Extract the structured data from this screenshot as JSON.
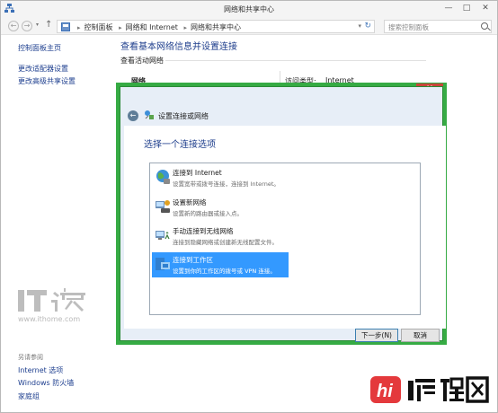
{
  "window": {
    "title": "网络和共享中心",
    "controls": {
      "minimize": "—",
      "maximize": "□",
      "close": "✕"
    }
  },
  "addressbar": {
    "back": "←",
    "forward": "→",
    "up": "↑",
    "crumbs": [
      "控制面板",
      "网络和 Internet",
      "网络和共享中心"
    ],
    "search_placeholder": "搜索控制面板"
  },
  "leftpane": {
    "home": "控制面板主页",
    "links": [
      "更改适配器设置",
      "更改高级共享设置"
    ],
    "see_also_heading": "另请参阅",
    "see_also": [
      "Internet 选项",
      "Windows 防火墙",
      "家庭组"
    ]
  },
  "main": {
    "heading": "查看基本网络信息并设置连接",
    "active_networks": "查看活动网络",
    "network_name": "网络",
    "access_type_label": "访问类型:",
    "access_type_value": "Internet"
  },
  "dialog": {
    "title": "设置连接或网络",
    "heading": "选择一个连接选项",
    "options": [
      {
        "title": "连接到 Internet",
        "desc": "设置宽带或拨号连接，连接到 Internet。",
        "icon": "globe-connect-icon",
        "selected": false
      },
      {
        "title": "设置新网络",
        "desc": "设置新的路由器或接入点。",
        "icon": "router-setup-icon",
        "selected": false
      },
      {
        "title": "手动连接到无线网络",
        "desc": "连接到隐藏网络或创建新无线配置文件。",
        "icon": "wireless-network-icon",
        "selected": false
      },
      {
        "title": "连接到工作区",
        "desc": "设置到你的工作区的拨号或 VPN 连接。",
        "icon": "workplace-vpn-icon",
        "selected": true
      }
    ],
    "next_button": "下一步(N)",
    "cancel_button": "取消",
    "close": "✕",
    "minimize": "—"
  },
  "watermarks": {
    "ithome_url": "www.ithome.com",
    "ithome_logo": "IT之家",
    "biancheng_logo": "编程网"
  },
  "colors": {
    "link": "#1e3f8f",
    "heading": "#1e3e8c",
    "dialog_border": "#36ab44",
    "dialog_close": "#c9453a",
    "selection": "#3399ff"
  }
}
